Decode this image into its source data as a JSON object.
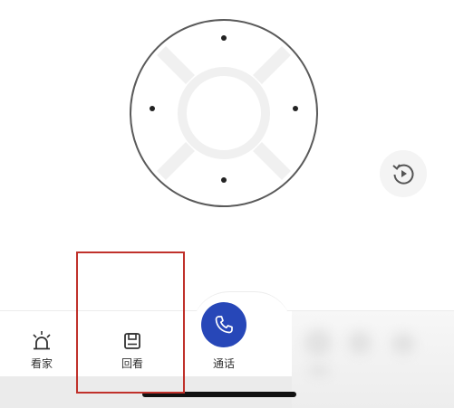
{
  "controls": {
    "dpad_icon": "direction-pad-icon",
    "replay_icon": "replay-icon"
  },
  "tabbar": {
    "tabs": [
      {
        "label": "看家",
        "icon": "alarm-light-icon"
      },
      {
        "label": "回看",
        "icon": "playback-icon"
      },
      {
        "label": "通话",
        "icon": "phone-icon"
      }
    ]
  },
  "colors": {
    "call_accent": "#2747b8",
    "highlight": "#c0312b"
  }
}
